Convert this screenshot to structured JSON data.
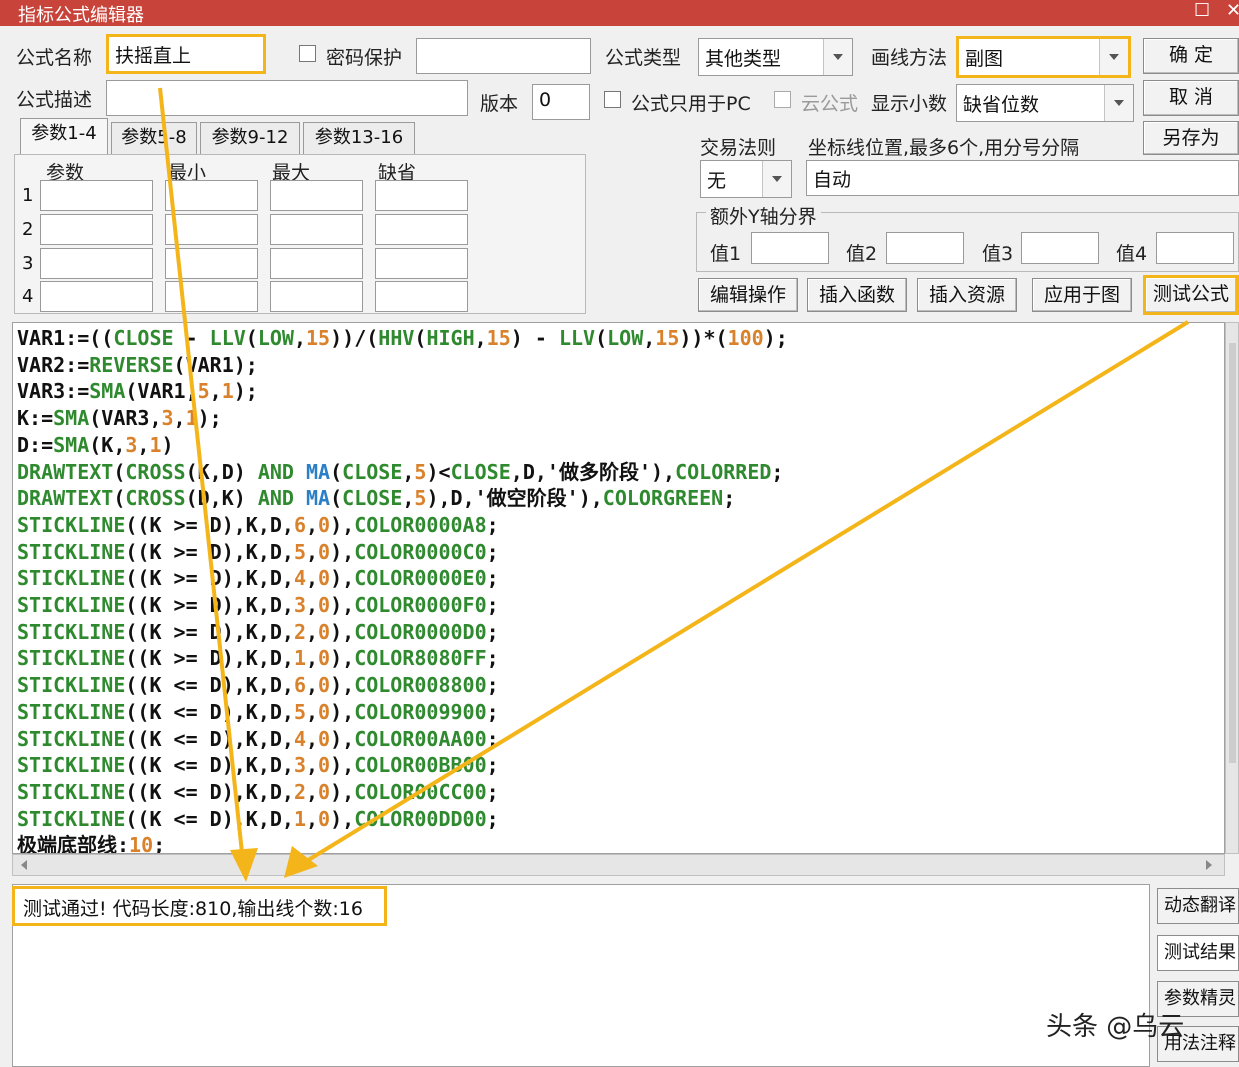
{
  "window": {
    "title": "指标公式编辑器",
    "maximize_glyph": "☐",
    "close_glyph": "✕"
  },
  "form": {
    "name_label": "公式名称",
    "name_value": "扶摇直上",
    "password_label": "密码保护",
    "type_label": "公式类型",
    "type_value": "其他类型",
    "draw_label": "画线方法",
    "draw_value": "副图",
    "desc_label": "公式描述",
    "desc_value": "",
    "version_label": "版本",
    "version_value": "0",
    "pc_only_label": "公式只用于PC",
    "cloud_label": "云公式",
    "decimals_label": "显示小数",
    "decimals_value": "缺省位数"
  },
  "buttons": {
    "ok": "确 定",
    "cancel": "取 消",
    "save_as": "另存为"
  },
  "tabs": [
    "参数1-4",
    "参数5-8",
    "参数9-12",
    "参数13-16"
  ],
  "params": {
    "headers": [
      "参数",
      "最小",
      "最大",
      "缺省"
    ],
    "rows": [
      "1",
      "2",
      "3",
      "4"
    ]
  },
  "trade": {
    "rule_label": "交易法则",
    "rule_value": "无",
    "coord_label": "坐标线位置,最多6个,用分号分隔",
    "coord_value": "自动"
  },
  "yaxis": {
    "group_label": "额外Y轴分界",
    "labels": [
      "值1",
      "值2",
      "值3",
      "值4"
    ]
  },
  "actions": [
    "编辑操作",
    "插入函数",
    "插入资源",
    "应用于图",
    "测试公式"
  ],
  "code_lines": [
    [
      [
        "VAR1:=((",
        "#111"
      ],
      [
        "CLOSE",
        "#2f8a2f"
      ],
      [
        " - ",
        "#111"
      ],
      [
        "LLV",
        "#2f8a2f"
      ],
      [
        "(",
        "#111"
      ],
      [
        "LOW",
        "#2f8a2f"
      ],
      [
        ",",
        "#111"
      ],
      [
        "15",
        "#d9822b"
      ],
      [
        "))/(",
        "#111"
      ],
      [
        "HHV",
        "#2f8a2f"
      ],
      [
        "(",
        "#111"
      ],
      [
        "HIGH",
        "#2f8a2f"
      ],
      [
        ",",
        "#111"
      ],
      [
        "15",
        "#d9822b"
      ],
      [
        ") - ",
        "#111"
      ],
      [
        "LLV",
        "#2f8a2f"
      ],
      [
        "(",
        "#111"
      ],
      [
        "LOW",
        "#2f8a2f"
      ],
      [
        ",",
        "#111"
      ],
      [
        "15",
        "#d9822b"
      ],
      [
        "))*(",
        "#111"
      ],
      [
        "100",
        "#d9822b"
      ],
      [
        ");",
        "#111"
      ]
    ],
    [
      [
        "VAR2:=",
        "#111"
      ],
      [
        "REVERSE",
        "#2f8a2f"
      ],
      [
        "(VAR1);",
        "#111"
      ]
    ],
    [
      [
        "VAR3:=",
        "#111"
      ],
      [
        "SMA",
        "#2f8a2f"
      ],
      [
        "(VAR1,",
        "#111"
      ],
      [
        "5",
        "#d9822b"
      ],
      [
        ",",
        "#111"
      ],
      [
        "1",
        "#d9822b"
      ],
      [
        ");",
        "#111"
      ]
    ],
    [
      [
        "K:=",
        "#111"
      ],
      [
        "SMA",
        "#2f8a2f"
      ],
      [
        "(VAR3,",
        "#111"
      ],
      [
        "3",
        "#d9822b"
      ],
      [
        ",",
        "#111"
      ],
      [
        "1",
        "#d9822b"
      ],
      [
        ");",
        "#111"
      ]
    ],
    [
      [
        "D:=",
        "#111"
      ],
      [
        "SMA",
        "#2f8a2f"
      ],
      [
        "(K,",
        "#111"
      ],
      [
        "3",
        "#d9822b"
      ],
      [
        ",",
        "#111"
      ],
      [
        "1",
        "#d9822b"
      ],
      [
        ")",
        "#111"
      ]
    ],
    [
      [
        "DRAWTEXT",
        "#2f8a2f"
      ],
      [
        "(",
        "#111"
      ],
      [
        "CROSS",
        "#2f8a2f"
      ],
      [
        "(K,D) ",
        "#111"
      ],
      [
        "AND",
        "#2f8a2f"
      ],
      [
        " ",
        "#111"
      ],
      [
        "MA",
        "#2a7fc7"
      ],
      [
        "(",
        "#111"
      ],
      [
        "CLOSE",
        "#2f8a2f"
      ],
      [
        ",",
        "#111"
      ],
      [
        "5",
        "#d9822b"
      ],
      [
        ")<",
        "#111"
      ],
      [
        "CLOSE",
        "#2f8a2f"
      ],
      [
        ",D,'做多阶段'),",
        "#111"
      ],
      [
        "COLORRED",
        "#2f8a2f"
      ],
      [
        ";",
        "#111"
      ]
    ],
    [
      [
        "DRAWTEXT",
        "#2f8a2f"
      ],
      [
        "(",
        "#111"
      ],
      [
        "CROSS",
        "#2f8a2f"
      ],
      [
        "(D,K) ",
        "#111"
      ],
      [
        "AND",
        "#2f8a2f"
      ],
      [
        " ",
        "#111"
      ],
      [
        "MA",
        "#2a7fc7"
      ],
      [
        "(",
        "#111"
      ],
      [
        "CLOSE",
        "#2f8a2f"
      ],
      [
        ",",
        "#111"
      ],
      [
        "5",
        "#d9822b"
      ],
      [
        "),D,'做空阶段'),",
        "#111"
      ],
      [
        "COLORGREEN",
        "#2f8a2f"
      ],
      [
        ";",
        "#111"
      ]
    ],
    [
      [
        "STICKLINE",
        "#2f8a2f"
      ],
      [
        "((K >= D),K,D,",
        "#111"
      ],
      [
        "6",
        "#d9822b"
      ],
      [
        ",",
        "#111"
      ],
      [
        "0",
        "#d9822b"
      ],
      [
        "),",
        "#111"
      ],
      [
        "COLOR0000A8",
        "#2f8a2f"
      ],
      [
        ";",
        "#111"
      ]
    ],
    [
      [
        "STICKLINE",
        "#2f8a2f"
      ],
      [
        "((K >= D),K,D,",
        "#111"
      ],
      [
        "5",
        "#d9822b"
      ],
      [
        ",",
        "#111"
      ],
      [
        "0",
        "#d9822b"
      ],
      [
        "),",
        "#111"
      ],
      [
        "COLOR0000C0",
        "#2f8a2f"
      ],
      [
        ";",
        "#111"
      ]
    ],
    [
      [
        "STICKLINE",
        "#2f8a2f"
      ],
      [
        "((K >= D),K,D,",
        "#111"
      ],
      [
        "4",
        "#d9822b"
      ],
      [
        ",",
        "#111"
      ],
      [
        "0",
        "#d9822b"
      ],
      [
        "),",
        "#111"
      ],
      [
        "COLOR0000E0",
        "#2f8a2f"
      ],
      [
        ";",
        "#111"
      ]
    ],
    [
      [
        "STICKLINE",
        "#2f8a2f"
      ],
      [
        "((K >= D),K,D,",
        "#111"
      ],
      [
        "3",
        "#d9822b"
      ],
      [
        ",",
        "#111"
      ],
      [
        "0",
        "#d9822b"
      ],
      [
        "),",
        "#111"
      ],
      [
        "COLOR0000F0",
        "#2f8a2f"
      ],
      [
        ";",
        "#111"
      ]
    ],
    [
      [
        "STICKLINE",
        "#2f8a2f"
      ],
      [
        "((K >= D),K,D,",
        "#111"
      ],
      [
        "2",
        "#d9822b"
      ],
      [
        ",",
        "#111"
      ],
      [
        "0",
        "#d9822b"
      ],
      [
        "),",
        "#111"
      ],
      [
        "COLOR0000D0",
        "#2f8a2f"
      ],
      [
        ";",
        "#111"
      ]
    ],
    [
      [
        "STICKLINE",
        "#2f8a2f"
      ],
      [
        "((K >= D),K,D,",
        "#111"
      ],
      [
        "1",
        "#d9822b"
      ],
      [
        ",",
        "#111"
      ],
      [
        "0",
        "#d9822b"
      ],
      [
        "),",
        "#111"
      ],
      [
        "COLOR8080FF",
        "#2f8a2f"
      ],
      [
        ";",
        "#111"
      ]
    ],
    [
      [
        "STICKLINE",
        "#2f8a2f"
      ],
      [
        "((K <= D),K,D,",
        "#111"
      ],
      [
        "6",
        "#d9822b"
      ],
      [
        ",",
        "#111"
      ],
      [
        "0",
        "#d9822b"
      ],
      [
        "),",
        "#111"
      ],
      [
        "COLOR008800",
        "#2f8a2f"
      ],
      [
        ";",
        "#111"
      ]
    ],
    [
      [
        "STICKLINE",
        "#2f8a2f"
      ],
      [
        "((K <= D),K,D,",
        "#111"
      ],
      [
        "5",
        "#d9822b"
      ],
      [
        ",",
        "#111"
      ],
      [
        "0",
        "#d9822b"
      ],
      [
        "),",
        "#111"
      ],
      [
        "COLOR009900",
        "#2f8a2f"
      ],
      [
        ";",
        "#111"
      ]
    ],
    [
      [
        "STICKLINE",
        "#2f8a2f"
      ],
      [
        "((K <= D),K,D,",
        "#111"
      ],
      [
        "4",
        "#d9822b"
      ],
      [
        ",",
        "#111"
      ],
      [
        "0",
        "#d9822b"
      ],
      [
        "),",
        "#111"
      ],
      [
        "COLOR00AA00",
        "#2f8a2f"
      ],
      [
        ";",
        "#111"
      ]
    ],
    [
      [
        "STICKLINE",
        "#2f8a2f"
      ],
      [
        "((K <= D),K,D,",
        "#111"
      ],
      [
        "3",
        "#d9822b"
      ],
      [
        ",",
        "#111"
      ],
      [
        "0",
        "#d9822b"
      ],
      [
        "),",
        "#111"
      ],
      [
        "COLOR00BB00",
        "#2f8a2f"
      ],
      [
        ";",
        "#111"
      ]
    ],
    [
      [
        "STICKLINE",
        "#2f8a2f"
      ],
      [
        "((K <= D),K,D,",
        "#111"
      ],
      [
        "2",
        "#d9822b"
      ],
      [
        ",",
        "#111"
      ],
      [
        "0",
        "#d9822b"
      ],
      [
        "),",
        "#111"
      ],
      [
        "COLOR00CC00",
        "#2f8a2f"
      ],
      [
        ";",
        "#111"
      ]
    ],
    [
      [
        "STICKLINE",
        "#2f8a2f"
      ],
      [
        "((K <= D),K,D,",
        "#111"
      ],
      [
        "1",
        "#d9822b"
      ],
      [
        ",",
        "#111"
      ],
      [
        "0",
        "#d9822b"
      ],
      [
        "),",
        "#111"
      ],
      [
        "COLOR00DD00",
        "#2f8a2f"
      ],
      [
        ";",
        "#111"
      ]
    ],
    [
      [
        "极端底部线:",
        "#111"
      ],
      [
        "10",
        "#d9822b"
      ],
      [
        ";",
        "#111"
      ]
    ]
  ],
  "result": {
    "text": "测试通过! 代码长度:810,输出线个数:16"
  },
  "side_buttons": [
    "动态翻译",
    "测试结果",
    "参数精灵",
    "用法注释"
  ],
  "watermark": "头条 @乌云",
  "colors": {
    "title_bar": "#c8443a",
    "highlight": "#f3b519",
    "keyword": "#2f8a2f",
    "number": "#d9822b",
    "function": "#2a7fc7"
  }
}
